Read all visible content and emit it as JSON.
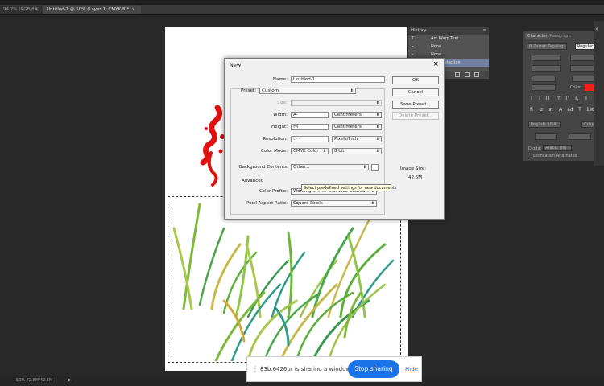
{
  "tabs": [
    {
      "label": "94.7% (RGB/8#)"
    },
    {
      "label": "Untitled-1 @ 50% (Layer 1, CMYK/8)*"
    }
  ],
  "history": {
    "title": "History",
    "items": [
      {
        "label": "Arc Warp Text"
      },
      {
        "label": "None"
      },
      {
        "label": "None"
      },
      {
        "label": "Load Selection"
      }
    ]
  },
  "dialog": {
    "title": "New",
    "name_label": "Name:",
    "name_value": "Untitled-1",
    "preset_label": "Preset:",
    "preset_value": "Custom",
    "size_label": "Size:",
    "size_value": "",
    "width_label": "Width:",
    "width_value": "A-",
    "width_unit": "Centimeters",
    "height_label": "Height:",
    "height_value": "٢٩",
    "height_unit": "Centimeters",
    "resolution_label": "Resolution:",
    "resolution_value": "٢٠٠",
    "resolution_unit": "Pixels/Inch",
    "color_mode_label": "Color Mode:",
    "color_mode_value": "CMYK Color",
    "bit_depth": "8 bit",
    "bg_label": "Background Contents:",
    "bg_value": "Other...",
    "advanced_label": "Advanced",
    "color_profile_label": "Color Profile:",
    "color_profile_value": "Working CMYK: U.S. Web Coated...",
    "pixel_aspect_label": "Pixel Aspect Ratio:",
    "pixel_aspect_value": "Square Pixels",
    "buttons": {
      "ok": "OK",
      "cancel": "Cancel",
      "save_preset": "Save Preset...",
      "delete_preset": "Delete Preset..."
    },
    "image_size_label": "Image Size:",
    "image_size_value": "42.6M",
    "tooltip": "Select predefined settings for new documents"
  },
  "character_panel": {
    "tabs": [
      "Character",
      "Paragraph"
    ],
    "font_family": "B Zarrah Tagalog",
    "font_style": "Regular",
    "color_label": "Color:",
    "language": "English: USA",
    "antialias": "Crisp",
    "digits_label": "Digits:",
    "digits_value": "Arabic (HI)",
    "justification": "Justification Alternates"
  },
  "status": {
    "zoom": "50% 42.6M/42.6M"
  },
  "share_bar": {
    "text": "83b.6426ur is sharing a window.",
    "stop_label": "Stop sharing",
    "hide_label": "Hide"
  },
  "colors": {
    "accent": "#1a73e8",
    "foreground_swatch": "#ff1c1c"
  }
}
